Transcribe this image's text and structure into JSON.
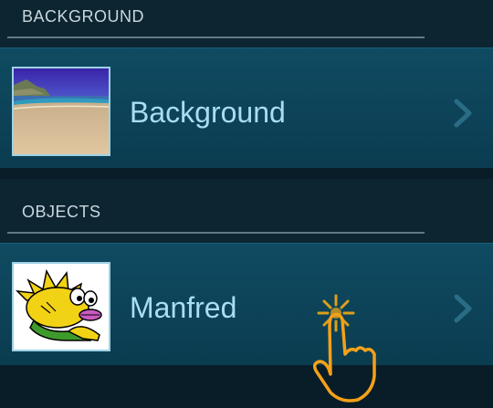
{
  "sections": [
    {
      "title": "BACKGROUND",
      "items": [
        {
          "label": "Background",
          "thumbnail_icon": "beach-landscape-thumbnail"
        }
      ]
    },
    {
      "title": "OBJECTS",
      "items": [
        {
          "label": "Manfred",
          "thumbnail_icon": "yellow-fish-creature-thumbnail"
        }
      ]
    }
  ],
  "row_chevron_icon": "chevron-right-icon",
  "tap_cursor_icon": "tap-hand-cursor-icon",
  "colors": {
    "header_bg": "#0c2531",
    "row_bg": "#0f4b62",
    "row_label": "#a9ddf5",
    "thumb_border": "#9ed2e4",
    "cursor_orange": "#f5a01a"
  }
}
